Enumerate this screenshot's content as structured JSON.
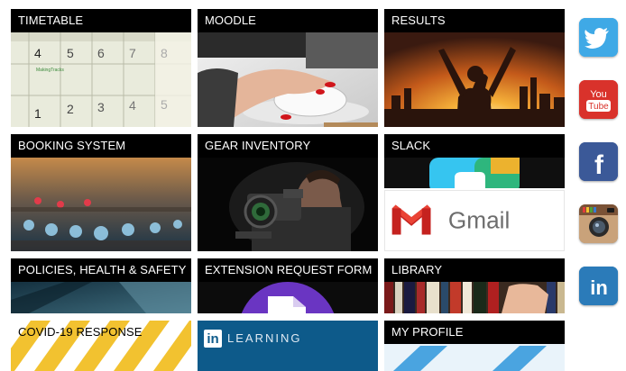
{
  "tiles": {
    "timetable": "TIMETABLE",
    "moodle": "MOODLE",
    "results": "RESULTS",
    "booking": "BOOKING SYSTEM",
    "gear": "GEAR INVENTORY",
    "slack": "SLACK",
    "gmail": "Gmail",
    "policies": "POLICIES, HEALTH & SAFETY",
    "extension": "EXTENSION REQUEST FORM",
    "library": "LIBRARY",
    "covid": "COVID-19 RESPONSE",
    "linkedin_learning": "LEARNING",
    "linkedin_in": "in",
    "profile": "MY PROFILE"
  },
  "calendar": {
    "brand": "MakingTracks",
    "numbers": [
      "4",
      "5",
      "6",
      "7",
      "8",
      "1",
      "2",
      "3",
      "4",
      "5"
    ]
  },
  "social": {
    "twitter": "twitter-icon",
    "youtube_text": "You\nTube",
    "facebook_text": "f",
    "instagram": "instagram-icon",
    "linkedin_text": "in"
  },
  "colors": {
    "twitter": "#3fa9e6",
    "youtube": "#d9322b",
    "facebook": "#3b5998",
    "linkedin": "#2b7bb9",
    "covid_yellow": "#f2c230",
    "linkedin_learning_bg": "#0d5a8a"
  }
}
